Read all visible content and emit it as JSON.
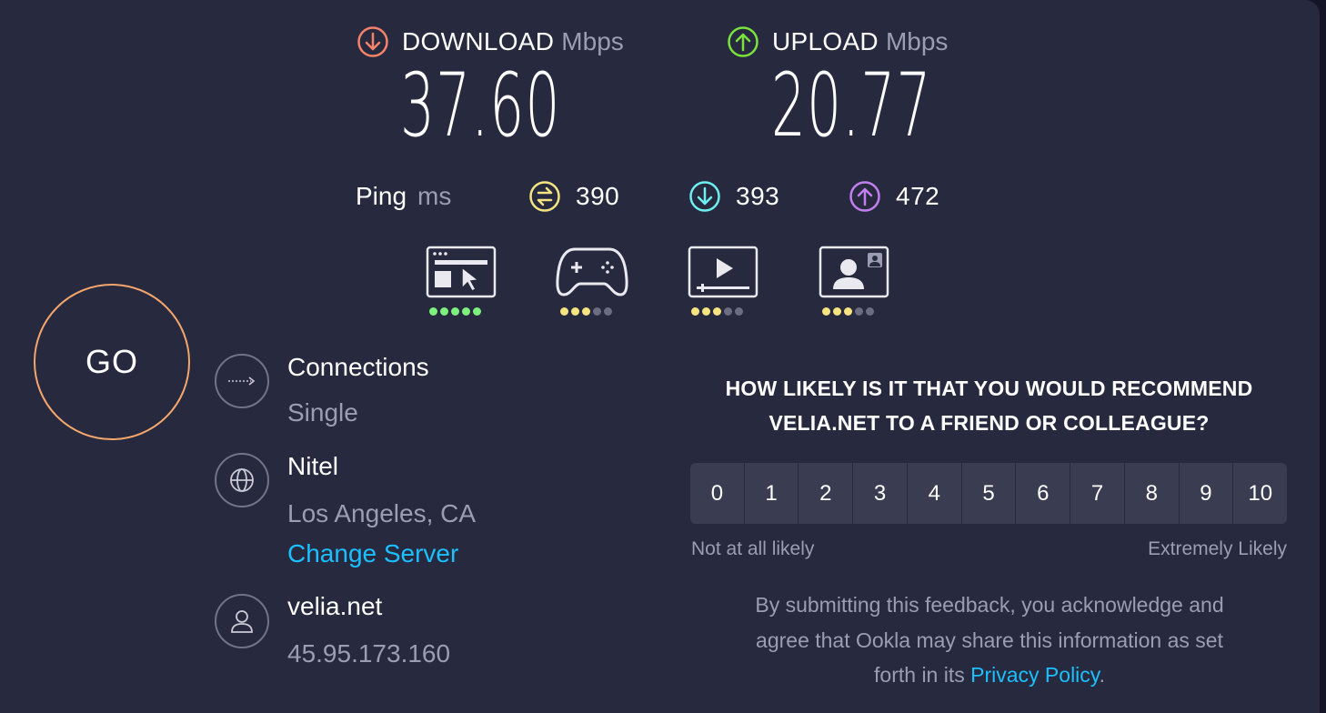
{
  "colors": {
    "download": "#f5826a",
    "upload": "#7ae23d",
    "ping_idle": "#f6e481",
    "ping_down": "#6ff0f0",
    "ping_up": "#c27ff0",
    "go_ring": "#f5a66d",
    "link": "#1cbfff"
  },
  "download": {
    "title": "DOWNLOAD",
    "unit": "Mbps",
    "value": "37.60",
    "icon": "arrow-down-circle-icon"
  },
  "upload": {
    "title": "UPLOAD",
    "unit": "Mbps",
    "value": "20.77",
    "icon": "arrow-up-circle-icon"
  },
  "ping": {
    "label": "Ping",
    "unit": "ms",
    "idle": "390",
    "down": "393",
    "up": "472"
  },
  "quality": [
    {
      "icon": "web-browsing-icon",
      "rating": 5,
      "max": 5
    },
    {
      "icon": "gamepad-icon",
      "rating": 3,
      "max": 5
    },
    {
      "icon": "video-streaming-icon",
      "rating": 3,
      "max": 5
    },
    {
      "icon": "video-call-icon",
      "rating": 3,
      "max": 5
    }
  ],
  "go_label": "GO",
  "connections": {
    "title": "Connections",
    "value": "Single"
  },
  "server": {
    "title": "Nitel",
    "location": "Los Angeles, CA",
    "change_link": "Change Server"
  },
  "provider": {
    "title": "velia.net",
    "ip": "45.95.173.160"
  },
  "survey": {
    "question_line1": "HOW LIKELY IS IT THAT YOU WOULD RECOMMEND",
    "question_line2": "VELIA.NET TO A FRIEND OR COLLEAGUE?",
    "options": [
      "0",
      "1",
      "2",
      "3",
      "4",
      "5",
      "6",
      "7",
      "8",
      "9",
      "10"
    ],
    "low_label": "Not at all likely",
    "high_label": "Extremely Likely",
    "disclaimer_line1": "By submitting this feedback, you acknowledge and",
    "disclaimer_line2": "agree that Ookla may share this information as set",
    "disclaimer_line3_prefix": "forth in its ",
    "privacy_link": "Privacy Policy",
    "disclaimer_suffix": "."
  }
}
